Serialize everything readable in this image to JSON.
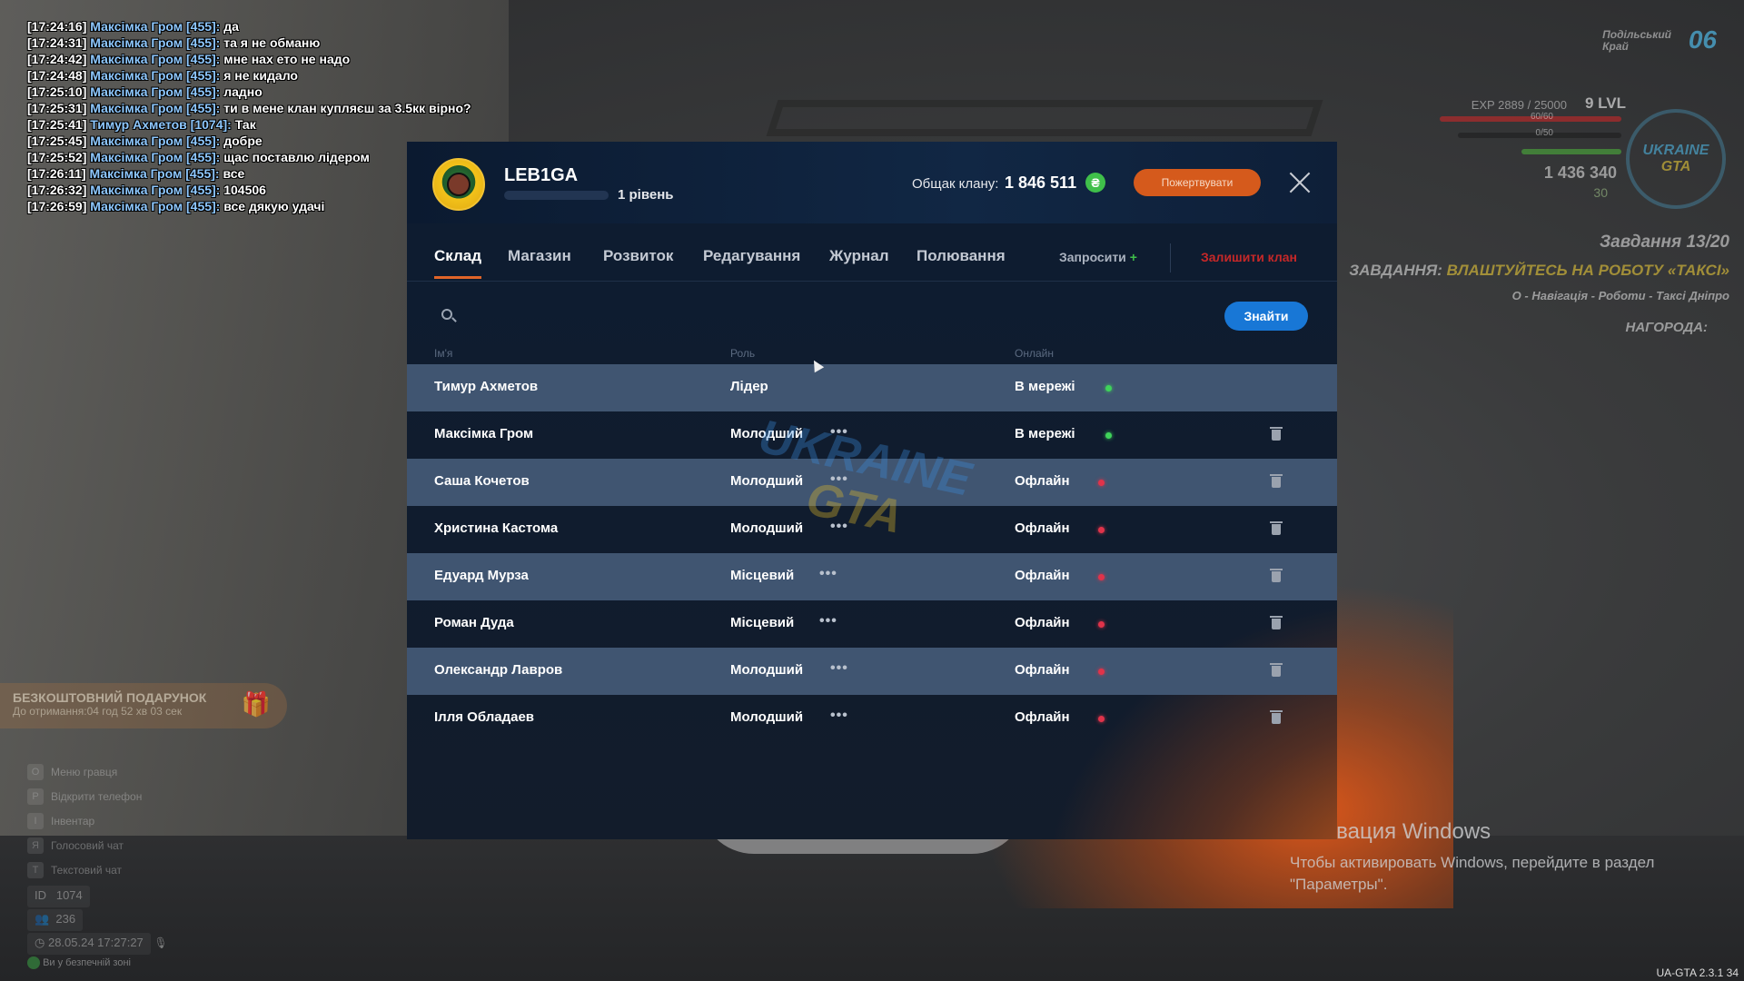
{
  "chat": [
    {
      "time": "[17:24:16]",
      "nick": "Максімка Гром [455]:",
      "msg": "да"
    },
    {
      "time": "[17:24:31]",
      "nick": "Максімка Гром [455]:",
      "msg": "та я не обманю"
    },
    {
      "time": "[17:24:42]",
      "nick": "Максімка Гром [455]:",
      "msg": "мне нах ето не надо"
    },
    {
      "time": "[17:24:48]",
      "nick": "Максімка Гром [455]:",
      "msg": "я не кидало"
    },
    {
      "time": "[17:25:10]",
      "nick": "Максімка Гром [455]:",
      "msg": "ладно"
    },
    {
      "time": "[17:25:31]",
      "nick": "Максімка Гром [455]:",
      "msg": "ти в мене клан купляєш за 3.5кк вірно?"
    },
    {
      "time": "[17:25:41]",
      "nick": "Тимур Ахметов [1074]:",
      "msg": "Так"
    },
    {
      "time": "[17:25:45]",
      "nick": "Максімка Гром [455]:",
      "msg": "добре"
    },
    {
      "time": "[17:25:52]",
      "nick": "Максімка Гром [455]:",
      "msg": "щас поставлю лідером"
    },
    {
      "time": "[17:26:11]",
      "nick": "Максімка Гром [455]:",
      "msg": "все"
    },
    {
      "time": "[17:26:32]",
      "nick": "Максімка Гром [455]:",
      "msg": "104506"
    },
    {
      "time": "[17:26:59]",
      "nick": "Максімка Гром [455]:",
      "msg": "все дякую удачі"
    }
  ],
  "hud": {
    "region_line1": "Подільський",
    "region_line2": "Край",
    "region_num": "06",
    "exp": "EXP 2889 / 25000",
    "level": "9 LVL",
    "bar1": "60/60",
    "bar2": "0/50",
    "money": "1 436 340",
    "coins": "30",
    "logo_line1": "UKRAINE",
    "logo_line2": "GTA",
    "task_title": "Завдання 13/20",
    "task_prefix": "ЗАВДАННЯ:",
    "task_highlight": "ВЛАШТУЙТЕСЬ НА РОБОТУ «ТАКСІ»",
    "task_hint": "O - Навігація - Роботи - Таксі Дніпро",
    "reward": "НАГОРОДА:"
  },
  "gift": {
    "title": "БЕЗКОШТОВНИЙ ПОДАРУНОК",
    "subtitle": "До отримання:04 год 52 хв 03 сек"
  },
  "keys": [
    {
      "key": "O",
      "label": "Меню гравця"
    },
    {
      "key": "P",
      "label": "Відкрити телефон"
    },
    {
      "key": "I",
      "label": "Інвентар"
    },
    {
      "key": "Я",
      "label": "Голосовий чат"
    },
    {
      "key": "T",
      "label": "Текстовий чат"
    }
  ],
  "stats": {
    "id_label": "ID",
    "id": "1074",
    "players": "236",
    "datetime": "28.05.24 17:27:27",
    "safe_zone": "Ви у безпечній зоні"
  },
  "windows": {
    "title": "Активация Windows",
    "line1": "Чтобы активировать Windows, перейдите в раздел",
    "line2": "\"Параметры\"."
  },
  "version": "UA-GTA 2.3.1   34",
  "clan": {
    "name": "LEB1GA",
    "level": "1 рівень",
    "treasury_label": "Общак клану:",
    "treasury_value": "1 846 511",
    "currency_symbol": "₴",
    "donate_label": "Пожертвувати"
  },
  "tabs": [
    "Склад",
    "Магазин",
    "Розвиток",
    "Редагування",
    "Журнал",
    "Полювання"
  ],
  "invite_label": "Запросити",
  "invite_plus": "+",
  "leave_label": "Залишити клан",
  "search": {
    "placeholder": "",
    "button": "Знайти"
  },
  "columns": {
    "name": "Ім'я",
    "role": "Роль",
    "online": "Онлайн"
  },
  "members": [
    {
      "name": "Тимур Ахметов",
      "role": "Лідер",
      "status": "В мережі"
    },
    {
      "name": "Максімка Гром",
      "role": "Молодший",
      "status": "В мережі"
    },
    {
      "name": "Саша Кочетов",
      "role": "Молодший",
      "status": "Офлайн"
    },
    {
      "name": "Христина Кастома",
      "role": "Молодший",
      "status": "Офлайн"
    },
    {
      "name": "Едуард Мурза",
      "role": "Місцевий",
      "status": "Офлайн"
    },
    {
      "name": "Роман Дуда",
      "role": "Місцевий",
      "status": "Офлайн"
    },
    {
      "name": "Олександр Лавров",
      "role": "Молодший",
      "status": "Офлайн"
    },
    {
      "name": "Ілля Обладаев",
      "role": "Молодший",
      "status": "Офлайн"
    }
  ],
  "watermark": {
    "line1": "UKRAINE",
    "line2": "GTA"
  },
  "colors": {
    "accent": "#e06428",
    "online": "#3fd35a",
    "offline": "#e0334a",
    "button": "#1877d6"
  }
}
